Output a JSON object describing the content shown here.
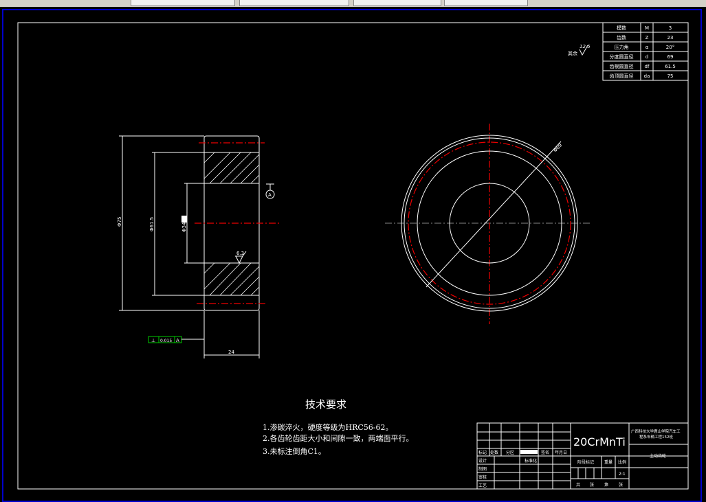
{
  "window": {
    "tabs": [
      "",
      "",
      "",
      "",
      ""
    ]
  },
  "params_table": [
    {
      "name": "模数",
      "symbol": "M",
      "value": "3"
    },
    {
      "name": "齿数",
      "symbol": "Z",
      "value": "23"
    },
    {
      "name": "压力角",
      "symbol": "α",
      "value": "20°"
    },
    {
      "name": "分度圆直径",
      "symbol": "d",
      "value": "69"
    },
    {
      "name": "齿根圆直径",
      "symbol": "df",
      "value": "61.5"
    },
    {
      "name": "齿顶圆直径",
      "symbol": "da",
      "value": "75"
    }
  ],
  "roughness_other": {
    "label": "其余",
    "value": "12.5"
  },
  "section_view": {
    "dim_outer": "Φ75",
    "dim_root": "Φ61.5",
    "dim_bore": "Φ34",
    "dim_width": "24",
    "roughness": "6.3",
    "datum": "A",
    "tolerance": {
      "symbol": "⊥",
      "value": "0.015",
      "datum": "A"
    }
  },
  "front_view": {
    "dim_pitch": "Φ69"
  },
  "tech_req": {
    "title": "技术要求",
    "items": [
      "1.渗碳淬火，硬度等级为HRC56-62。",
      "2.各齿轮齿距大小和间隙一致，两端面平行。",
      "3.未标注倒角C1。"
    ]
  },
  "title_block": {
    "material": "20CrMnTi",
    "school": [
      "广西科技大学鹿山学院汽车工",
      "程系车辆工程152班"
    ],
    "part_name": "主动齿轮",
    "labels": {
      "mark": "标记",
      "count": "处数",
      "zone": "分区",
      "sign": "签名",
      "date": "年月日",
      "design": "设计",
      "standard": "标准化",
      "draw": "制图",
      "review": "审核",
      "process": "工艺",
      "stage": "阶段标记",
      "weight": "重量",
      "scale": "比例",
      "total": "共",
      "sheet": "张",
      "no": "第",
      "sheet2": "张"
    },
    "scale_value": "2:1"
  },
  "colors": {
    "centerline": "#e00000",
    "tolerance": "#00cc00",
    "frame": "#0000cc"
  }
}
